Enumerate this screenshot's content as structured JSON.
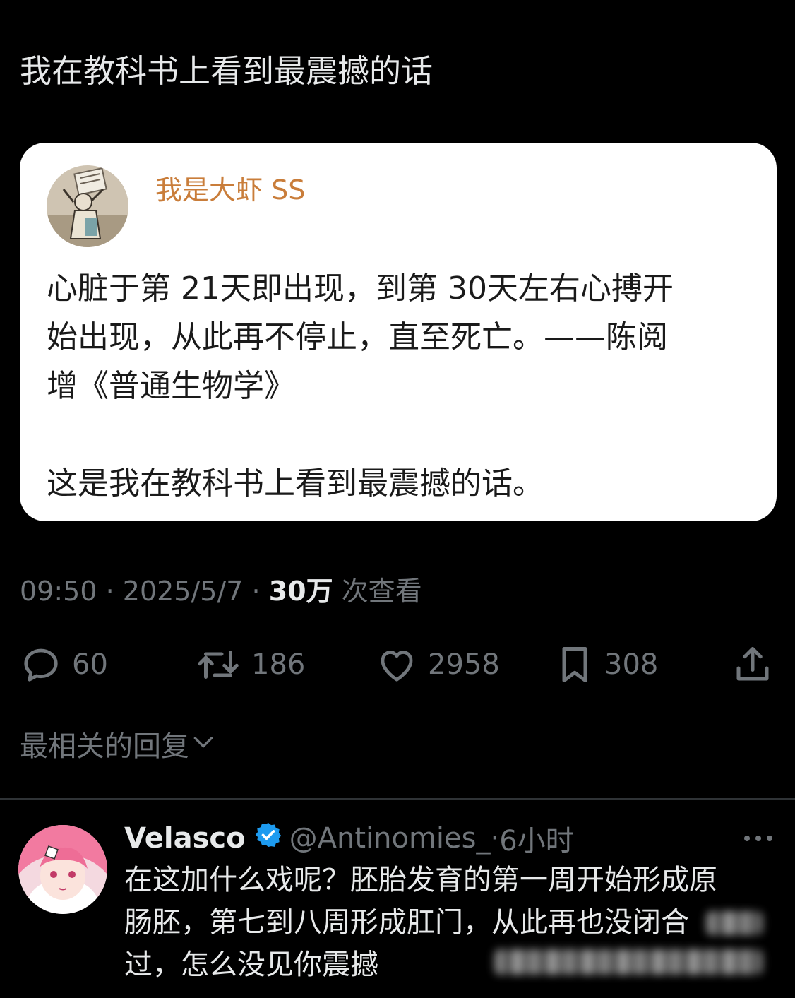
{
  "post": {
    "text": "我在教科书上看到最震撼的话"
  },
  "quote": {
    "author": "我是大虾 SS",
    "lines": [
      "心脏于第 21天即出现，到第 30天左右心搏开",
      "始出现，从此再不停止，直至死亡。——陈阅",
      "增《普通生物学》",
      "这是我在教科书上看到最震撼的话。"
    ]
  },
  "meta": {
    "time": "09:50",
    "sep1": " · ",
    "date": "2025/5/7",
    "sep2": " · ",
    "views": "30万",
    "views_suffix": " 次查看"
  },
  "actions": {
    "replies": "60",
    "reposts": "186",
    "likes": "2958",
    "bookmarks": "308"
  },
  "sort": {
    "label": "最相关的回复"
  },
  "reply": {
    "name": "Velasco",
    "handle": "@Antinomies_",
    "time_prefix": " · ",
    "time": "6小时",
    "lines": [
      "在这加什么戏呢？胚胎发育的第一周开始形成原",
      "肠胚，第七到八周形成肛门，从此再也没闭合",
      "过，怎么没见你震撼"
    ]
  },
  "icons": {
    "reply": "reply-bubble-icon",
    "repost": "repost-icon",
    "like": "heart-icon",
    "bookmark": "bookmark-icon",
    "share": "share-icon",
    "verified": "verified-badge-icon",
    "more": "more-dots-icon",
    "chevron": "chevron-down-icon"
  },
  "colors": {
    "background": "#000000",
    "text": "#e7e9ea",
    "muted": "#71767b",
    "quote_author": "#c97d3a",
    "verified": "#1d9bf0"
  }
}
